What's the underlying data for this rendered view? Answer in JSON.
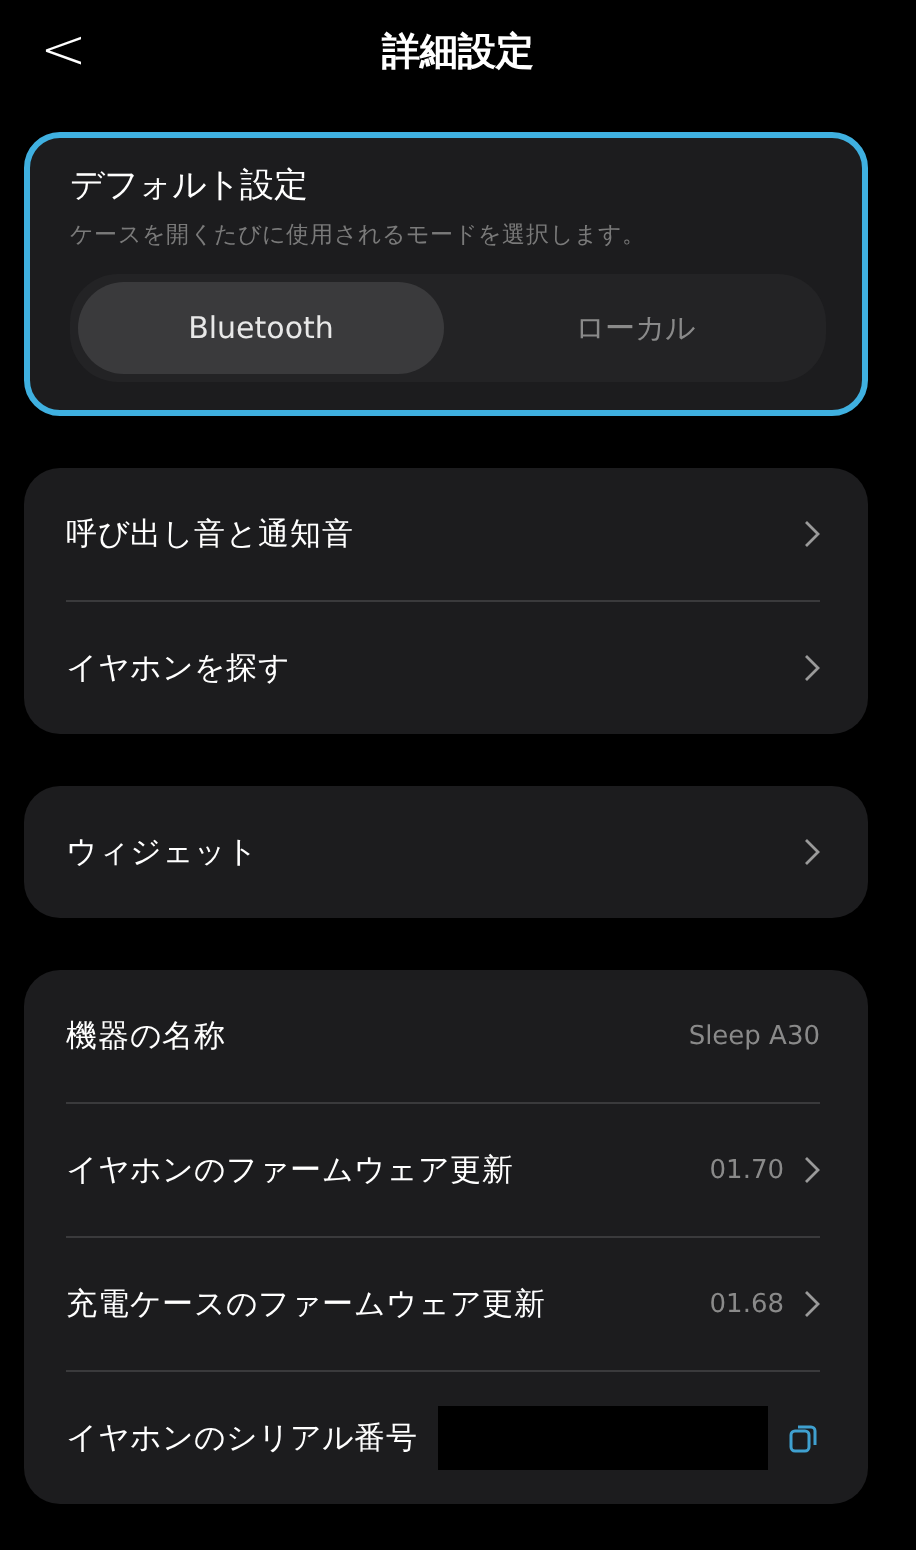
{
  "header": {
    "title": "詳細設定",
    "back": "<"
  },
  "default_mode": {
    "title": "デフォルト設定",
    "description": "ケースを開くたびに使用されるモードを選択します。",
    "options": [
      {
        "label": "Bluetooth",
        "selected": true
      },
      {
        "label": "ローカル",
        "selected": false
      }
    ]
  },
  "groups": [
    {
      "rows": [
        {
          "kind": "link",
          "label": "呼び出し音と通知音"
        },
        {
          "kind": "link",
          "label": "イヤホンを探す"
        }
      ]
    },
    {
      "rows": [
        {
          "kind": "link",
          "label": "ウィジェット"
        }
      ]
    },
    {
      "rows": [
        {
          "kind": "value",
          "label": "機器の名称",
          "value": "Sleep A30"
        },
        {
          "kind": "value_link",
          "label": "イヤホンのファームウェア更新",
          "value": "01.70"
        },
        {
          "kind": "value_link",
          "label": "充電ケースのファームウェア更新",
          "value": "01.68"
        },
        {
          "kind": "serial",
          "label": "イヤホンのシリアル番号"
        }
      ]
    }
  ]
}
